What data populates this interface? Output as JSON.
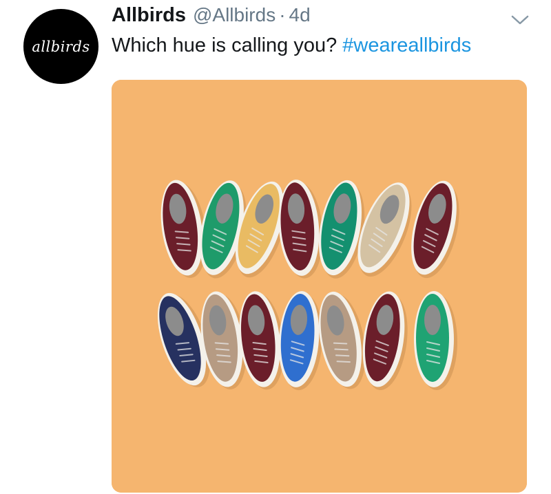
{
  "tweet": {
    "avatar": {
      "logo_text": "allbirds",
      "background": "#000000"
    },
    "display_name": "Allbirds",
    "handle": "@Allbirds",
    "separator": "·",
    "timestamp": "4d",
    "caret_icon": "chevron-down-icon",
    "text": {
      "body": "Which hue is calling you? ",
      "hashtag": "#weareallbirds"
    },
    "media": {
      "background": "#f5b56f",
      "shoe_rows": [
        [
          "#6b1e2a",
          "#1e9b6a",
          "#e9bb63",
          "#6b1e2a",
          "#14906f",
          "#d4c2a3",
          "#6b1e2a"
        ],
        [
          "#263160",
          "#b69b83",
          "#6b1e2a",
          "#2f6fcf",
          "#b69b83",
          "#6b1e2a",
          "#1fa373"
        ]
      ]
    }
  },
  "colors": {
    "text_primary": "#14171a",
    "text_secondary": "#657786",
    "link": "#1b95e0"
  }
}
